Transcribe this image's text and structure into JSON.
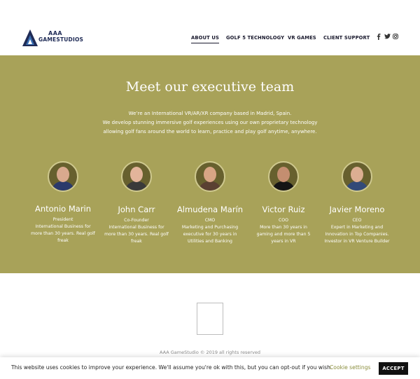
{
  "header": {
    "logo": {
      "line1": "AAA",
      "line2": "GAMESTUDIOS"
    },
    "nav": [
      {
        "label": "ABOUT US",
        "active": true
      },
      {
        "label": "GOLF 5 TECHNOLOGY",
        "active": false
      },
      {
        "label": "VR GAMES",
        "active": false
      },
      {
        "label": "CLIENT SUPPORT",
        "active": false
      }
    ],
    "social": [
      "facebook-icon",
      "twitter-icon",
      "instagram-icon"
    ]
  },
  "team": {
    "title": "Meet our executive team",
    "intro": [
      "We’re an International VR/AR/XR company based in Madrid, Spain.",
      "We develop stunning immersive golf experiences using our own proprietary technology",
      "allowing golf fans around the world to learn, practice and play golf anytime, anywhere."
    ],
    "members": [
      {
        "name": "Antonio Marin",
        "lines": [
          "President",
          "International Business for",
          "more than 30 years. Real golf",
          "freak"
        ]
      },
      {
        "name": "John Carr",
        "lines": [
          "Co-Founder",
          "International Business for",
          "more than 30 years. Real golf",
          "freak"
        ]
      },
      {
        "name": "Almudena Marín",
        "lines": [
          "CMO",
          "Marketing and Purchasing",
          "executive for 30 years in",
          "Utilities and Banking"
        ]
      },
      {
        "name": "Victor Ruiz",
        "lines": [
          "COO",
          "More than 30 years in",
          "gaming and more than 5",
          "years in VR"
        ]
      },
      {
        "name": "Javier Moreno",
        "lines": [
          "CEO",
          "Expert in Marketing and",
          "Innovation in Top Companies.",
          "Investor in VR Venture Builder"
        ]
      }
    ]
  },
  "footer": {
    "copyright": "AAA GameStudio © 2019 all rights reserved"
  },
  "cookie": {
    "text": "This website uses cookies to improve your experience. We'll assume you're ok with this, but you can opt-out if you wish.",
    "settings_label": "Cookie settings",
    "accept_label": "ACCEPT"
  },
  "colors": {
    "band": "#a8a259",
    "accent": "#8a8d3b",
    "navy": "#1f2b56"
  }
}
